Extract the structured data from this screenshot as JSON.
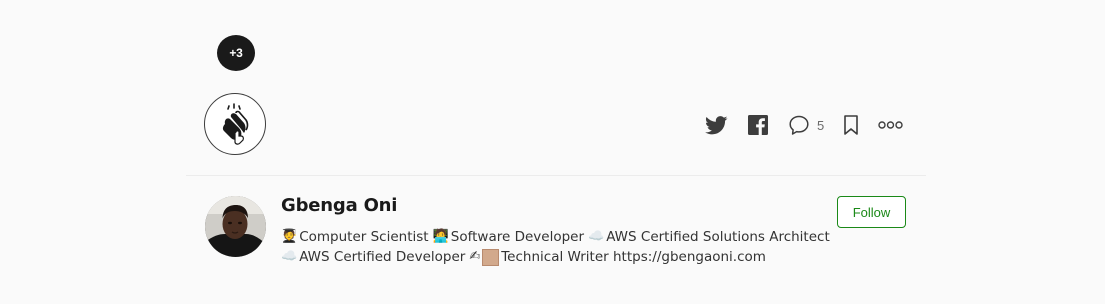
{
  "clap": {
    "count_badge": "+3",
    "icon": "clapping-hands-icon"
  },
  "actions": {
    "twitter_icon": "twitter-icon",
    "facebook_icon": "facebook-icon",
    "responses_icon": "speech-bubble-icon",
    "responses_count": "5",
    "bookmark_icon": "bookmark-icon",
    "more_icon": "more-dots-icon"
  },
  "author": {
    "name": "Gbenga Oni",
    "bio_line1_emoji1": "🧑‍🎓",
    "bio_line1_text1": "Computer Scientist",
    "bio_line1_emoji2": "🧑‍💻",
    "bio_line1_text2": "Software Developer",
    "bio_line1_emoji3": "☁️",
    "bio_line1_text3": "AWS Certified Solutions Architect",
    "bio_line2_emoji1": "☁️",
    "bio_line2_text1": "AWS Certified Developer",
    "bio_line2_emoji2": "✍",
    "bio_line2_text2": "Technical Writer https://gbengaoni.com",
    "follow_label": "Follow"
  },
  "colors": {
    "accent_green": "#1a8917",
    "badge_dark": "#1a1a1a"
  }
}
